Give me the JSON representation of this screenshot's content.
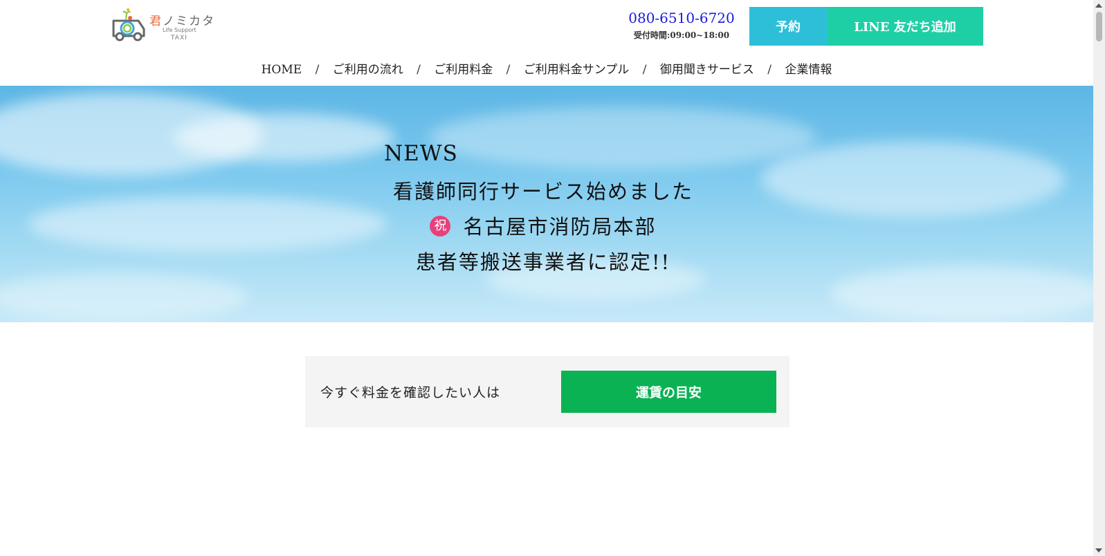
{
  "header": {
    "logo": {
      "name_accent": "君",
      "name_rest": "ノミカタ",
      "tagline": "Life Support",
      "sub": "TAXI"
    },
    "phone": "080-6510-6720",
    "hours": "受付時間:09:00~18:00",
    "reserve_label": "予約",
    "line_label": "LINE 友だち追加"
  },
  "nav": {
    "items": [
      {
        "label": "HOME"
      },
      {
        "label": "ご利用の流れ"
      },
      {
        "label": "ご利用料金"
      },
      {
        "label": "ご利用料金サンプル"
      },
      {
        "label": "御用聞きサービス"
      },
      {
        "label": "企業情報"
      }
    ],
    "separator": "/"
  },
  "hero": {
    "news_title": "NEWS",
    "line1": "看護師同行サービス始めました",
    "badge": "祝",
    "line2": "名古屋市消防局本部",
    "line3": "患者等搬送事業者に認定!!"
  },
  "fare": {
    "prompt": "今すぐ料金を確認したい人は",
    "button_label": "運賃の目安"
  },
  "colors": {
    "reserve": "#2ebfd8",
    "line": "#1ecfa6",
    "fare_button": "#0bb254",
    "phone": "#1a1ae0",
    "badge": "#e8407a"
  }
}
